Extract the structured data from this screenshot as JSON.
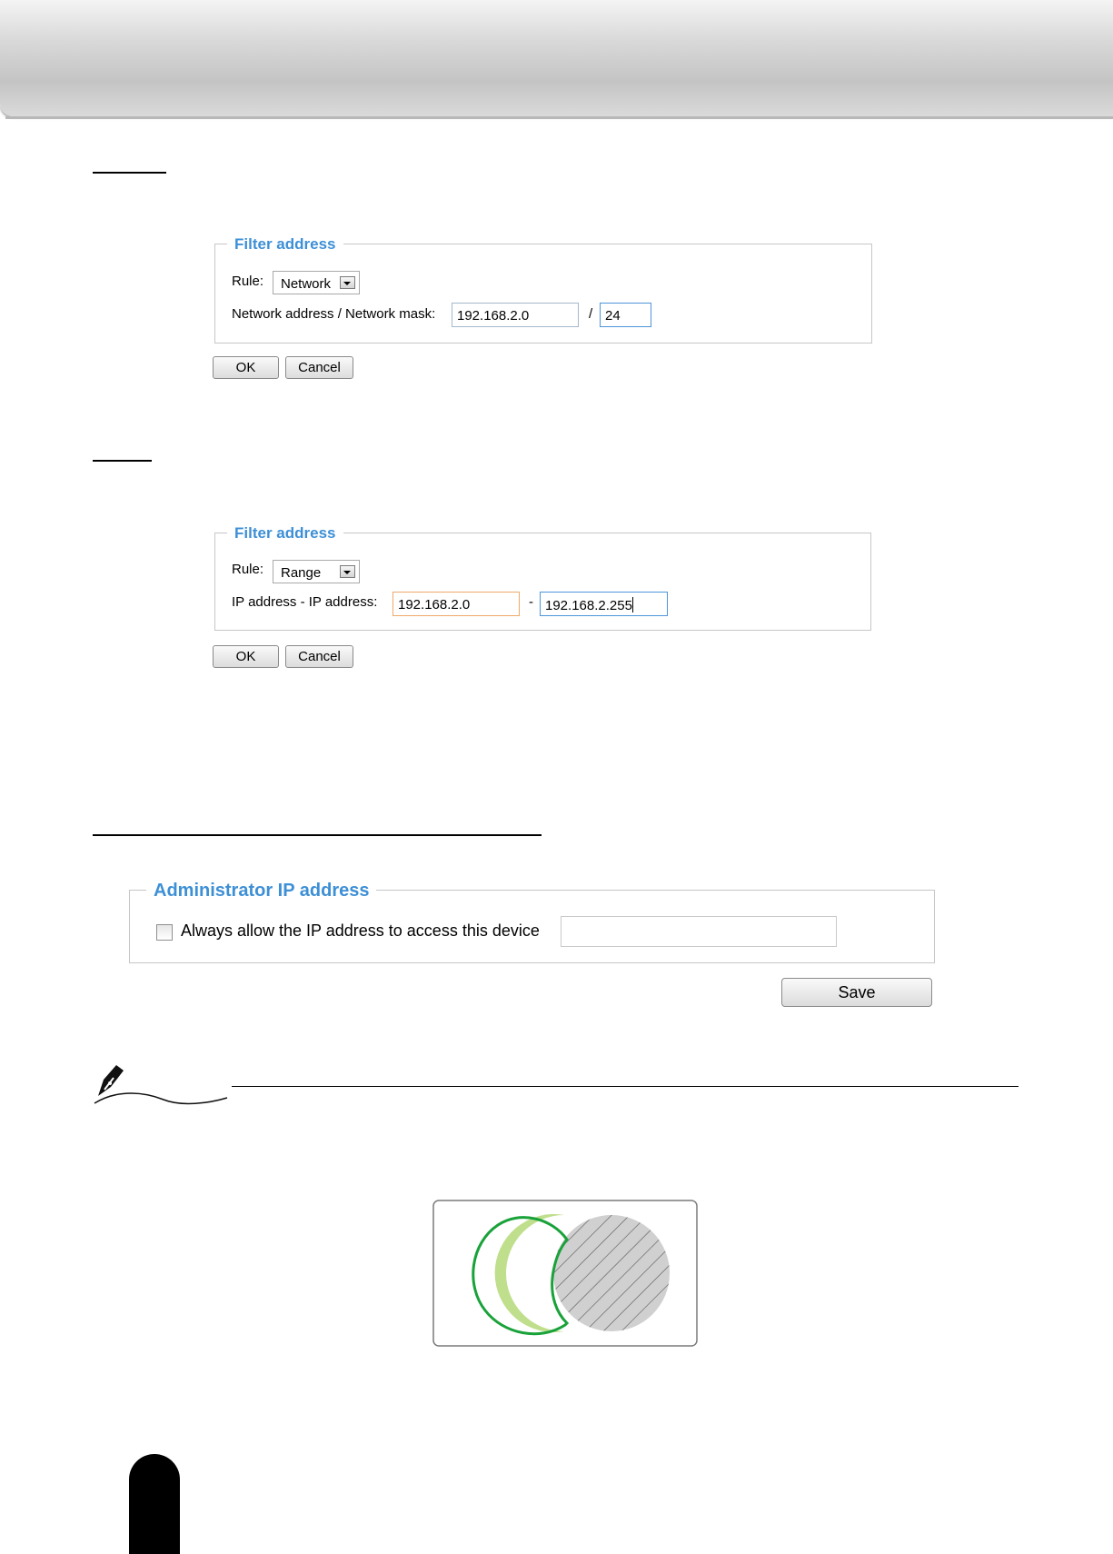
{
  "network_example": {
    "legend": "Filter address",
    "rule_label": "Rule:",
    "rule_value": "Network",
    "address_label": "Network address / Network mask:",
    "address_value": "192.168.2.0",
    "separator": "/",
    "mask_value": "24",
    "ok_label": "OK",
    "cancel_label": "Cancel"
  },
  "range_example": {
    "legend": "Filter address",
    "rule_label": "Rule:",
    "rule_value": "Range",
    "address_label": "IP address - IP address:",
    "start_value": "192.168.2.0",
    "separator": "-",
    "end_value": "192.168.2.255",
    "ok_label": "OK",
    "cancel_label": "Cancel"
  },
  "admin": {
    "legend": "Administrator IP address",
    "checkbox_label": "Always allow the IP address to access this device",
    "checkbox_checked": false,
    "ip_value": "",
    "save_label": "Save"
  },
  "colors": {
    "legend_blue": "#3d8fd6",
    "venn_green_fill": "#bfdf8c",
    "venn_green_stroke": "#1aa23a",
    "venn_gray_fill": "#d0d0d0"
  },
  "icons": [
    "pen-nib-icon",
    "dropdown-arrow-icon"
  ]
}
